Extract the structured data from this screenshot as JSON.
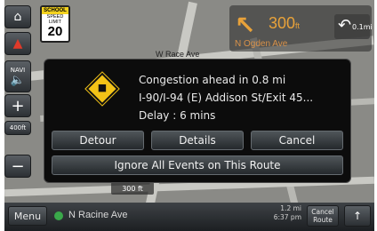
{
  "sidebar": {
    "home_icon": "home-icon",
    "nav_label": "NAVI",
    "zoom_in": "+",
    "zoom_out": "−",
    "zoom_level": "400ft"
  },
  "speed_sign": {
    "school": "SCHOOL",
    "label": "SPEED LIMIT",
    "value": "20"
  },
  "guidance": {
    "distance": "300",
    "unit": "ft",
    "next_distance": "0.1mi",
    "street": "N Ogden Ave"
  },
  "map": {
    "road_label": "W Race Ave",
    "scale": "300 ft"
  },
  "dialog": {
    "title": "Congestion ahead in 0.8 mi",
    "location": "I-90/I-94 (E) Addison St/Exit 45...",
    "delay": "Delay : 6 mins",
    "detour_label": "Detour",
    "details_label": "Details",
    "cancel_label": "Cancel",
    "ignore_label": "Ignore All Events on This Route"
  },
  "bottom": {
    "menu_label": "Menu",
    "current_street": "N Racine Ave",
    "eta_distance": "1.2 mi",
    "eta_time": "6:37 pm",
    "cancel_route_label": "Cancel Route"
  },
  "colors": {
    "warning": "#f3c317",
    "guidance": "#e8a23a"
  }
}
